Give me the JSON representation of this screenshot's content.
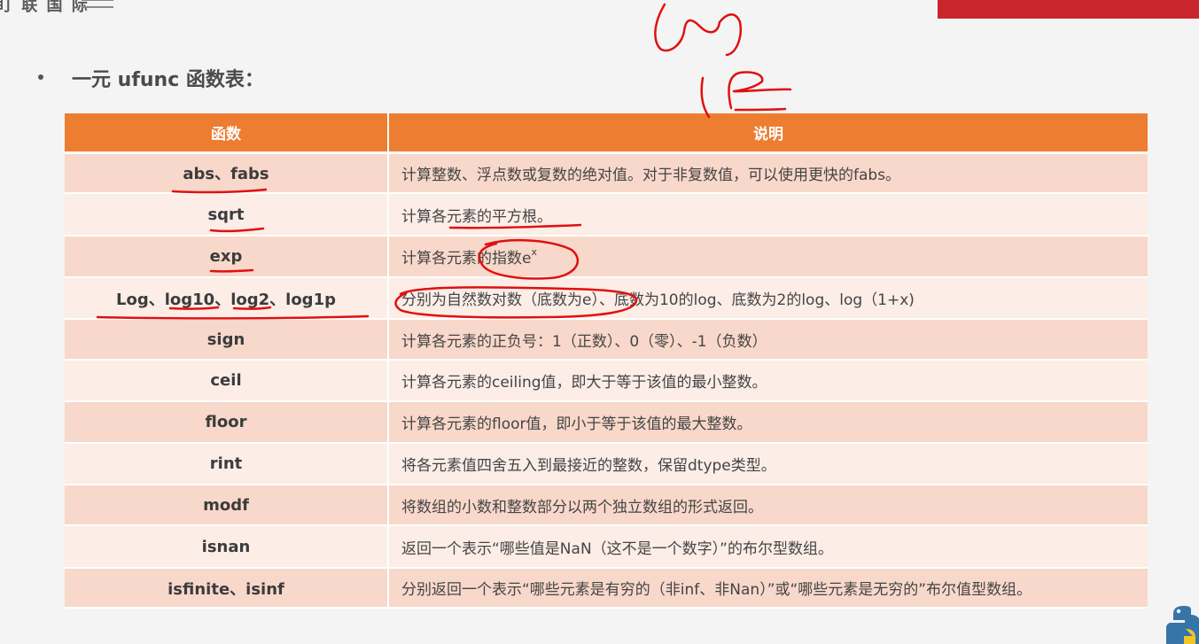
{
  "logo": {
    "text": "盯 联 国 际"
  },
  "heading": "一元 ufunc 函数表：",
  "table": {
    "headers": [
      "函数",
      "说明"
    ],
    "rows": [
      {
        "fn": "abs、fabs",
        "desc": "计算整数、浮点数或复数的绝对值。对于非复数值，可以使用更快的fabs。"
      },
      {
        "fn": "sqrt",
        "desc": "计算各元素的平方根。"
      },
      {
        "fn": "exp",
        "desc": "计算各元素的指数e",
        "sup": "x"
      },
      {
        "fn": "Log、log10、log2、log1p",
        "desc": "分别为自然数对数（底数为e）、底数为10的log、底数为2的log、log（1+x)"
      },
      {
        "fn": "sign",
        "desc": "计算各元素的正负号：1（正数）、0（零）、-1（负数）"
      },
      {
        "fn": "ceil",
        "desc": "计算各元素的ceiling值，即大于等于该值的最小整数。"
      },
      {
        "fn": "floor",
        "desc": "计算各元素的floor值，即小于等于该值的最大整数。"
      },
      {
        "fn": "rint",
        "desc": "将各元素值四舍五入到最接近的整数，保留dtype类型。"
      },
      {
        "fn": "modf",
        "desc": "将数组的小数和整数部分以两个独立数组的形式返回。"
      },
      {
        "fn": "isnan",
        "desc": "返回一个表示“哪些值是NaN（这不是一个数字）”的布尔型数组。"
      },
      {
        "fn": "isfinite、isinf",
        "desc": "分别返回一个表示“哪些元素是有穷的（非inf、非Nan）”或“哪些元素是无穷的”布尔值型数组。"
      }
    ]
  },
  "colors": {
    "header_bg": "#ed7d31",
    "row_odd": "#f8d8ca",
    "row_even": "#fcede7",
    "annotation": "#e01010",
    "top_bar": "#c9262b"
  },
  "icons": [
    "python-logo-icon"
  ]
}
